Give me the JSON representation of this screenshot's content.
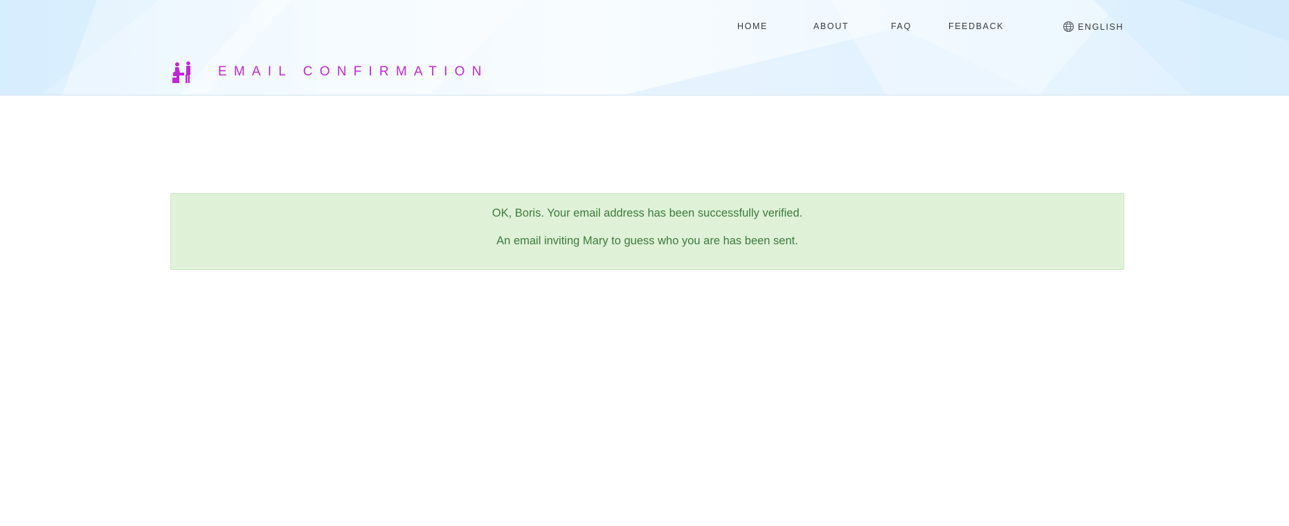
{
  "nav": {
    "items": [
      {
        "label": "HOME"
      },
      {
        "label": "ABOUT"
      },
      {
        "label": "FAQ"
      },
      {
        "label": "FEEDBACK"
      }
    ],
    "language": {
      "label": "ENGLISH",
      "icon": "globe-icon"
    }
  },
  "header": {
    "logo_icon": "couple-logo-icon",
    "title": "EMAIL CONFIRMATION"
  },
  "alert": {
    "type": "success",
    "messages": [
      "OK, Boris. Your email address has been successfully verified.",
      "An email inviting Mary to guess who you are has been sent."
    ]
  },
  "colors": {
    "accent": "#c026d3",
    "success_bg": "#dff2d8",
    "success_border": "#c9e6bf",
    "success_text": "#3c7a3c",
    "nav_text": "#333a40"
  }
}
